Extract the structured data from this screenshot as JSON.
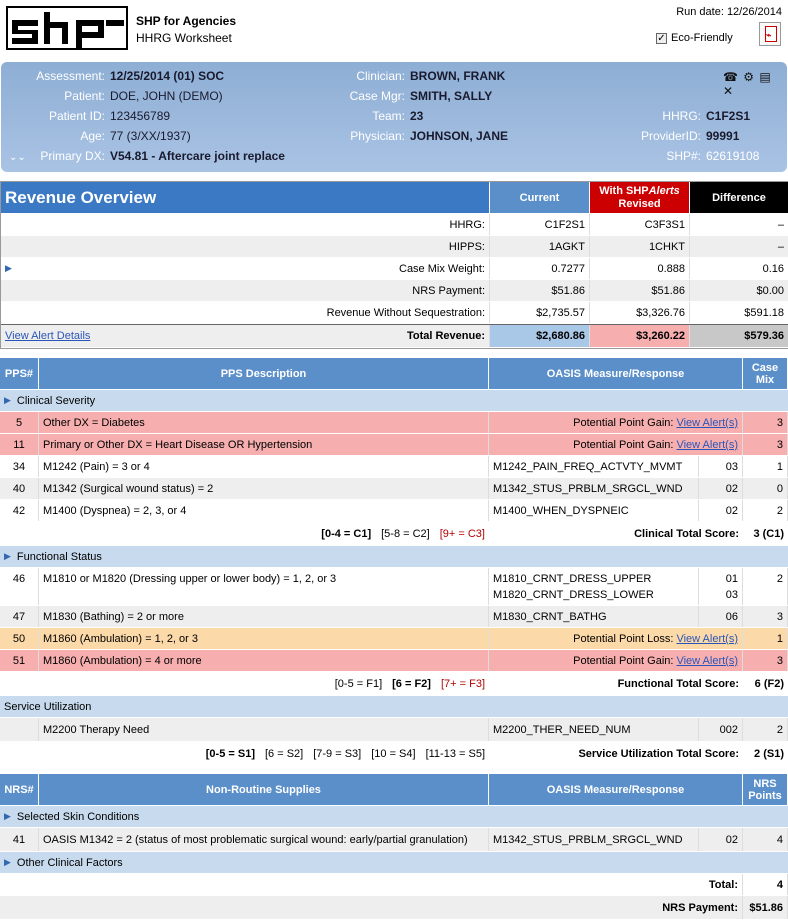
{
  "header": {
    "app_title": "SHP for Agencies",
    "app_subtitle": "HHRG Worksheet",
    "run_date": "Run date: 12/26/2014",
    "eco_label": "Eco-Friendly",
    "logo_text": "shp"
  },
  "patient": {
    "assessment_label": "Assessment:",
    "assessment": "12/25/2014 (01) SOC",
    "patient_label": "Patient:",
    "patient": "DOE, JOHN (DEMO)",
    "patient_id_label": "Patient ID:",
    "patient_id": "123456789",
    "age_label": "Age:",
    "age": "77 (3/XX/1937)",
    "primary_dx_label": "Primary DX:",
    "primary_dx": "V54.81 - Aftercare joint replace",
    "clinician_label": "Clinician:",
    "clinician": "BROWN, FRANK",
    "case_mgr_label": "Case Mgr:",
    "case_mgr": "SMITH, SALLY",
    "team_label": "Team:",
    "team": "23",
    "physician_label": "Physician:",
    "physician": "JOHNSON, JANE",
    "hhrg_label": "HHRG:",
    "hhrg": "C1F2S1",
    "provider_label": "ProviderID:",
    "provider": "99991",
    "shp_label": "SHP#:",
    "shp": "62619108"
  },
  "revenue": {
    "title": "Revenue Overview",
    "col_current": "Current",
    "col_revised_a": "With SHP",
    "col_revised_b": "Alerts",
    "col_revised_c": "Revised",
    "col_diff": "Difference",
    "rows": [
      {
        "label": "HHRG:",
        "current": "C1F2S1",
        "revised": "C3F3S1",
        "diff": "–"
      },
      {
        "label": "HIPPS:",
        "current": "1AGKT",
        "revised": "1CHKT",
        "diff": "–"
      },
      {
        "label": "Case Mix Weight:",
        "current": "0.7277",
        "revised": "0.888",
        "diff": "0.16"
      },
      {
        "label": "NRS Payment:",
        "current": "$51.86",
        "revised": "$51.86",
        "diff": "$0.00"
      },
      {
        "label": "Revenue Without Sequestration:",
        "current": "$2,735.57",
        "revised": "$3,326.76",
        "diff": "$591.18"
      }
    ],
    "alert_link": "View Alert Details",
    "total_label": "Total Revenue:",
    "total_current": "$2,680.86",
    "total_revised": "$3,260.22",
    "total_diff": "$579.36"
  },
  "pps": {
    "col_num": "PPS#",
    "col_desc": "PPS Description",
    "col_oasis": "OASIS Measure/Response",
    "col_case": "Case",
    "col_mix": "Mix",
    "clinical": {
      "title": "Clinical Severity",
      "rows": [
        {
          "num": "5",
          "desc": "Other DX = Diabetes",
          "oasis": "Potential Point Gain:",
          "link": "View Alert(s)",
          "resp": "",
          "score": "3"
        },
        {
          "num": "11",
          "desc": "Primary or Other DX = Heart Disease OR Hypertension",
          "oasis": "Potential Point Gain:",
          "link": "View Alert(s)",
          "resp": "",
          "score": "3"
        },
        {
          "num": "34",
          "desc": "M1242 (Pain) = 3 or 4",
          "oasis": "M1242_PAIN_FREQ_ACTVTY_MVMT",
          "resp": "03",
          "score": "1"
        },
        {
          "num": "40",
          "desc": "M1342 (Surgical wound status) = 2",
          "oasis": "M1342_STUS_PRBLM_SRGCL_WND",
          "resp": "02",
          "score": "0"
        },
        {
          "num": "42",
          "desc": "M1400 (Dyspnea) = 2, 3, or 4",
          "oasis": "M1400_WHEN_DYSPNEIC",
          "resp": "02",
          "score": "2"
        }
      ],
      "ranges": [
        "[0-4 = C1]",
        "[5-8 = C2]",
        "[9+ = C3]"
      ],
      "total_label": "Clinical Total Score:",
      "total": "3 (C1)"
    },
    "functional": {
      "title": "Functional Status",
      "rows": [
        {
          "num": "46",
          "desc": "M1810 or M1820 (Dressing upper or lower body) = 1, 2, or 3",
          "oasis": "M1810_CRNT_DRESS_UPPER",
          "oasis2": "M1820_CRNT_DRESS_LOWER",
          "resp": "01",
          "resp2": "03",
          "score": "2"
        },
        {
          "num": "47",
          "desc": "M1830 (Bathing) = 2 or more",
          "oasis": "M1830_CRNT_BATHG",
          "resp": "06",
          "score": "3"
        },
        {
          "num": "50",
          "desc": "M1860 (Ambulation) = 1, 2, or 3",
          "oasis": "Potential Point Loss:",
          "link": "View Alert(s)",
          "resp": "",
          "score": "1"
        },
        {
          "num": "51",
          "desc": "M1860 (Ambulation) = 4 or more",
          "oasis": "Potential Point Gain:",
          "link": "View Alert(s)",
          "resp": "",
          "score": "3"
        }
      ],
      "ranges": [
        "[0-5 = F1]",
        "[6 = F2]",
        "[7+ = F3]"
      ],
      "total_label": "Functional Total Score:",
      "total": "6 (F2)"
    },
    "service": {
      "title": "Service Utilization",
      "row": {
        "num": "",
        "desc": "M2200 Therapy Need",
        "oasis": "M2200_THER_NEED_NUM",
        "resp": "002",
        "score": "2"
      },
      "ranges": [
        "[0-5 = S1]",
        "[6 = S2]",
        "[7-9 = S3]",
        "[10 = S4]",
        "[11-13 = S5]"
      ],
      "total_label": "Service Utilization Total Score:",
      "total": "2 (S1)"
    }
  },
  "nrs": {
    "col_num": "NRS#",
    "col_desc": "Non-Routine Supplies",
    "col_oasis": "OASIS Measure/Response",
    "col_pts": "NRS",
    "col_pts2": "Points",
    "skin_title": "Selected Skin Conditions",
    "row": {
      "num": "41",
      "desc": "OASIS M1342 = 2 (status of most problematic surgical wound: early/partial granulation)",
      "oasis": "M1342_STUS_PRBLM_SRGCL_WND",
      "resp": "02",
      "score": "4"
    },
    "other_title": "Other Clinical Factors",
    "total_label": "Total:",
    "total": "4",
    "payment_label": "NRS Payment:",
    "payment": "$51.86"
  },
  "colors": {
    "header_blue": "#5b8fca",
    "alert_red": "#f6aeae",
    "loss_orange": "#fcd9a8",
    "revised_red": "#cc0000",
    "diff_black": "#000000"
  }
}
